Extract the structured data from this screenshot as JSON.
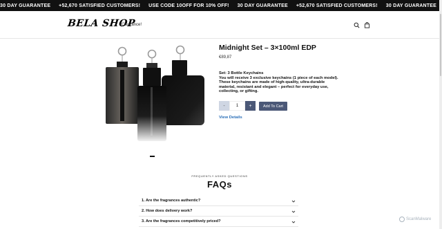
{
  "announcement": {
    "items": [
      "30 DAY GUARANTEE",
      "+52,670 SATISFIED CUSTOMERS!",
      "USE CODE 10OFF FOR 10% OFF!",
      "30 DAY GUARANTEE",
      "+52,670 SATISFIED CUSTOMERS!",
      "30 DAY GUARANTEE"
    ]
  },
  "header": {
    "logo": "BELA SHOP",
    "nav_link": "Clearance!",
    "icons": [
      "search-icon",
      "cart-icon"
    ]
  },
  "product": {
    "title": "Midnight Set – 3×100ml EDP",
    "price": "€89,87",
    "description_lines": [
      "Set: 3 Bottle Keychains",
      "You will receive 3 exclusive keychains (1 piece of each model).",
      "These keychains are made of high-quality, ultra-durable",
      "material, resistant and elegant – perfect for everyday use,",
      "collecting, or gifting."
    ],
    "quantity": {
      "minus": "-",
      "value": "1",
      "plus": "+"
    },
    "add_to_cart": "Add To Cart",
    "view_details": "View Details"
  },
  "faq": {
    "kicker": "FREQUENTLY ASKED QUESTIONS",
    "title": "FAQs",
    "items": [
      "1. Are the fragrances authentic?",
      "2. How does delivery work?",
      "3. Are the fragrances competitively priced?"
    ]
  },
  "watermark": "ScanMalware",
  "colors": {
    "announcement_bg": "#111111",
    "button_primary": "#4b5877",
    "link": "#2a6fb8"
  }
}
